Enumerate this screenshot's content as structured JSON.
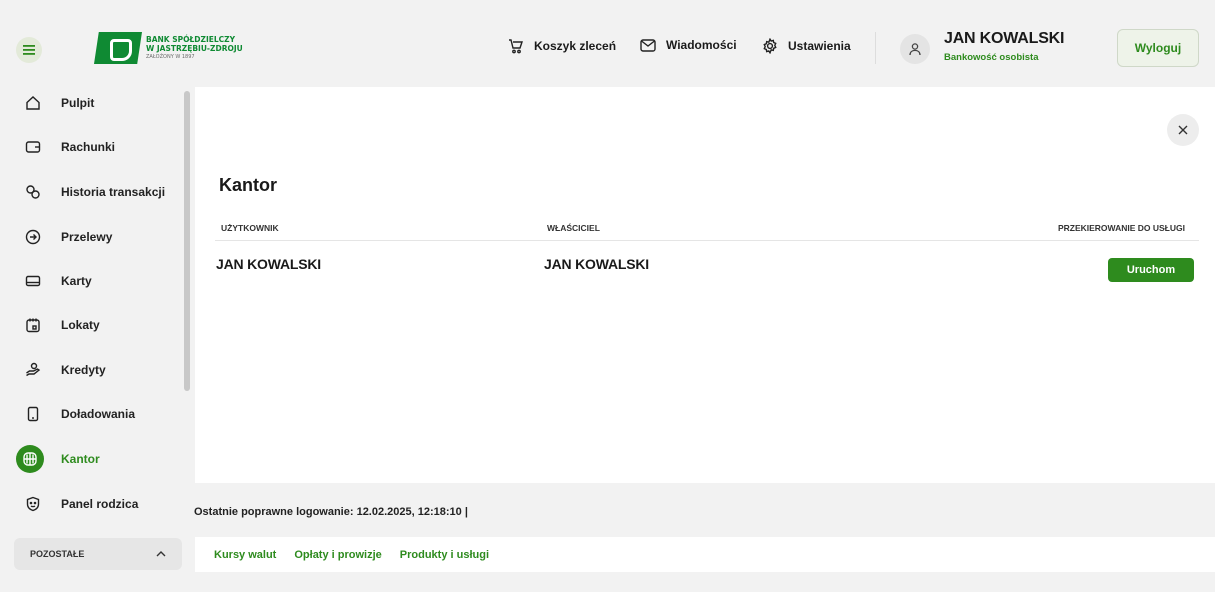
{
  "header": {
    "bank_name_line1": "BANK SPÓŁDZIELCZY",
    "bank_name_line2": "W JASTRZĘBIU-ZDROJU",
    "bank_founded": "ZAŁOŻONY W 1897",
    "nav": [
      {
        "label": "Koszyk zleceń",
        "icon": "cart-icon"
      },
      {
        "label": "Wiadomości",
        "icon": "envelope-icon"
      },
      {
        "label": "Ustawienia",
        "icon": "gear-icon"
      }
    ],
    "user_name": "JAN KOWALSKI",
    "user_type": "Bankowość osobista",
    "logout_label": "Wyloguj"
  },
  "sidebar": {
    "items": [
      {
        "label": "Pulpit",
        "icon": "home-icon"
      },
      {
        "label": "Rachunki",
        "icon": "wallet-icon"
      },
      {
        "label": "Historia transakcji",
        "icon": "coins-icon"
      },
      {
        "label": "Przelewy",
        "icon": "arrow-circle-icon"
      },
      {
        "label": "Karty",
        "icon": "card-icon"
      },
      {
        "label": "Lokaty",
        "icon": "calendar-icon"
      },
      {
        "label": "Kredyty",
        "icon": "hand-coin-icon"
      },
      {
        "label": "Doładowania",
        "icon": "phone-icon"
      },
      {
        "label": "Kantor",
        "icon": "globe-icon",
        "active": true
      },
      {
        "label": "Panel rodzica",
        "icon": "shield-icon"
      }
    ],
    "more_label": "POZOSTAŁE"
  },
  "main": {
    "title": "Kantor",
    "columns": [
      "UŻYTKOWNIK",
      "WŁAŚCICIEL",
      "PRZEKIEROWANIE DO USŁUGI"
    ],
    "rows": [
      {
        "user": "JAN KOWALSKI",
        "owner": "JAN KOWALSKI",
        "action_label": "Uruchom"
      }
    ]
  },
  "footer": {
    "last_login": "Ostatnie poprawne logowanie: 12.02.2025, 12:18:10  |",
    "links": [
      "Kursy walut",
      "Opłaty i prowizje",
      "Produkty i usługi"
    ]
  },
  "colors": {
    "brand_green": "#0f8a33",
    "accent_green": "#2e8b1e"
  }
}
